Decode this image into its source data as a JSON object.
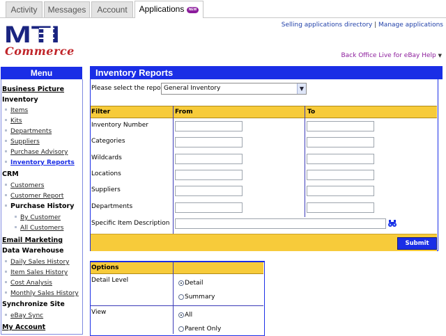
{
  "tabs": [
    {
      "label": "Activity"
    },
    {
      "label": "Messages"
    },
    {
      "label": "Account"
    },
    {
      "label": "Applications",
      "badge": "NEW"
    }
  ],
  "brand": {
    "logo_text": "MTI",
    "sub_text": "Commerce"
  },
  "header_links": {
    "selling_directory": "Selling applications directory",
    "separator": "|",
    "manage_apps": "Manage applications",
    "help": "Back Office Live for eBay Help",
    "help_arrow": "▼"
  },
  "menu": {
    "title": "Menu",
    "business_picture": "Business Picture",
    "inventory": "Inventory",
    "items": "Items",
    "kits": "Kits",
    "departments": "Departments",
    "suppliers": "Suppliers",
    "purchase_advisory": "Purchase Advisory",
    "inventory_reports": "Inventory Reports",
    "crm": "CRM",
    "customers": "Customers",
    "customer_report": "Customer Report",
    "purchase_history": "Purchase History",
    "by_customer": "By Customer",
    "all_customers": "All Customers",
    "email_marketing": "Email Marketing",
    "data_warehouse": "Data Warehouse",
    "daily_sales_history": "Daily Sales History",
    "item_sales_history": "Item Sales History",
    "cost_analysis": "Cost Analysis",
    "monthly_sales_history": "Monthly Sales History",
    "synchronize_site": "Synchronize Site",
    "ebay_sync": "eBay Sync",
    "my_account": "My Account"
  },
  "report": {
    "title": "Inventory Reports",
    "select_label": "Please select the report:",
    "selected": "General Inventory",
    "col_filter": "Filter",
    "col_from": "From",
    "col_to": "To",
    "filters": [
      "Inventory Number",
      "Categories",
      "Wildcards",
      "Locations",
      "Suppliers",
      "Departments"
    ],
    "specific_label": "Specific Item Description",
    "submit": "Submit"
  },
  "options": {
    "header": "Options",
    "detail_level_label": "Detail Level",
    "detail": "Detail",
    "summary": "Summary",
    "view_label": "View",
    "all": "All",
    "parent_only": "Parent Only"
  }
}
